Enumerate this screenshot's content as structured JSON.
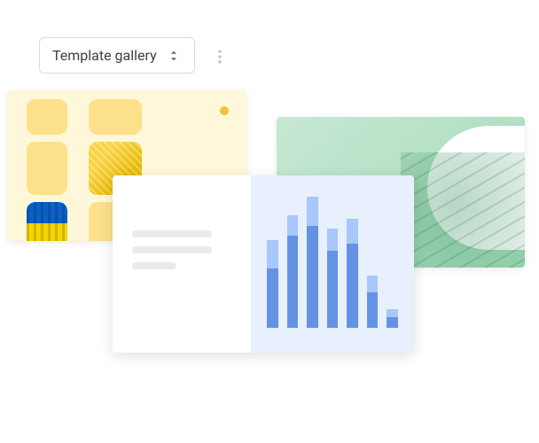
{
  "toolbar": {
    "gallery_label": "Template gallery"
  },
  "chart_data": {
    "type": "bar",
    "series": [
      {
        "name": "light",
        "values": [
          28,
          20,
          28,
          22,
          25,
          16,
          8
        ]
      },
      {
        "name": "dark",
        "values": [
          58,
          90,
          100,
          75,
          82,
          35,
          10
        ]
      }
    ],
    "categories": [
      "",
      "",
      "",
      "",
      "",
      "",
      ""
    ],
    "title": "",
    "xlabel": "",
    "ylabel": "",
    "ylim": [
      0,
      130
    ]
  },
  "colors": {
    "yellow_card": "#fef7d9",
    "green_card": "#a2dab8",
    "chart_bg": "#e8f0fe",
    "bar_light": "#a8c7fa",
    "bar_dark": "#6493e6"
  }
}
